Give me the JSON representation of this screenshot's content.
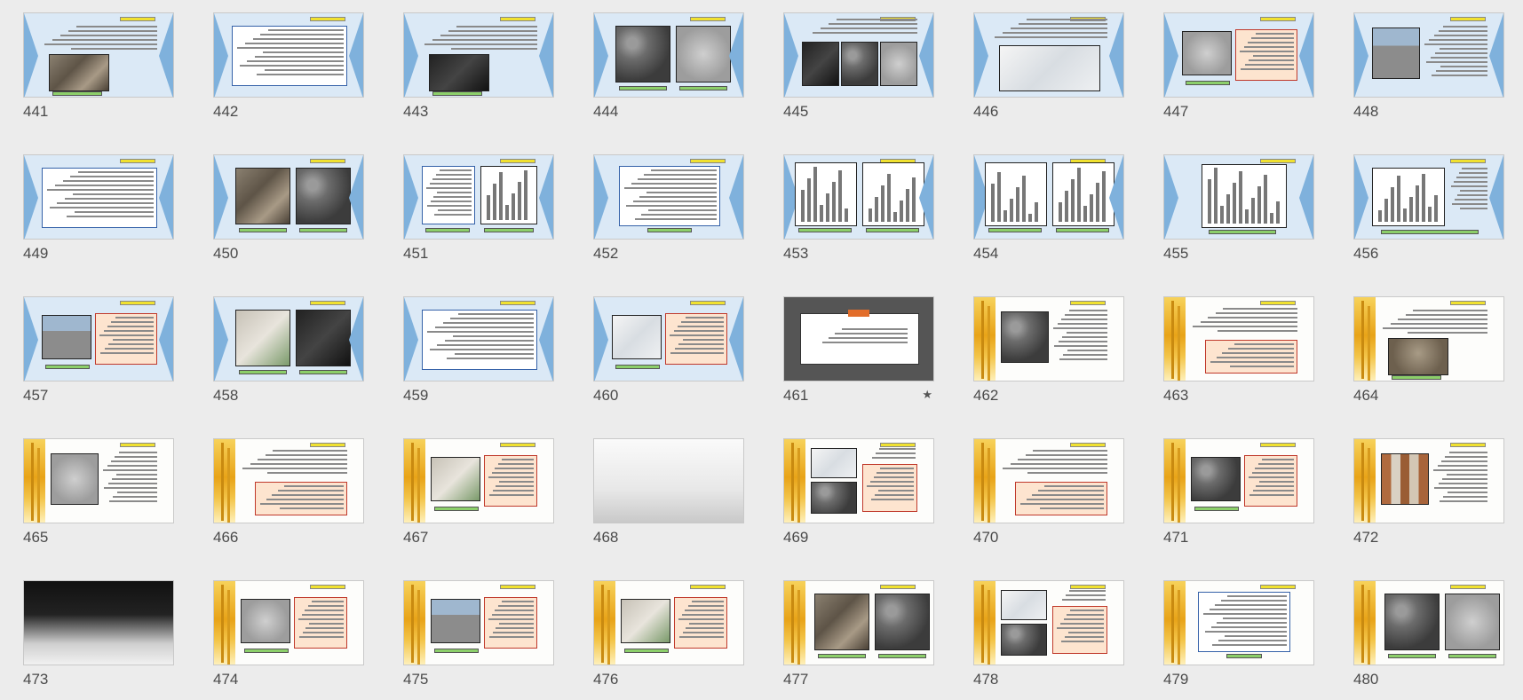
{
  "slides": [
    {
      "number": "441",
      "theme": "blue",
      "layout": "text-pic"
    },
    {
      "number": "442",
      "theme": "blue",
      "layout": "text"
    },
    {
      "number": "443",
      "theme": "blue",
      "layout": "text-pic"
    },
    {
      "number": "444",
      "theme": "blue",
      "layout": "two-pics"
    },
    {
      "number": "445",
      "theme": "blue",
      "layout": "three-pics"
    },
    {
      "number": "446",
      "theme": "blue",
      "layout": "wide-pic"
    },
    {
      "number": "447",
      "theme": "blue",
      "layout": "pic-box"
    },
    {
      "number": "448",
      "theme": "blue",
      "layout": "pic-text"
    },
    {
      "number": "449",
      "theme": "blue",
      "layout": "text"
    },
    {
      "number": "450",
      "theme": "blue",
      "layout": "two-pics"
    },
    {
      "number": "451",
      "theme": "blue",
      "layout": "table-chart"
    },
    {
      "number": "452",
      "theme": "blue",
      "layout": "table"
    },
    {
      "number": "453",
      "theme": "blue",
      "layout": "two-charts"
    },
    {
      "number": "454",
      "theme": "blue",
      "layout": "two-charts"
    },
    {
      "number": "455",
      "theme": "blue",
      "layout": "chart"
    },
    {
      "number": "456",
      "theme": "blue",
      "layout": "chart-text"
    },
    {
      "number": "457",
      "theme": "blue",
      "layout": "pic-box"
    },
    {
      "number": "458",
      "theme": "blue",
      "layout": "two-pics"
    },
    {
      "number": "459",
      "theme": "blue",
      "layout": "text"
    },
    {
      "number": "460",
      "theme": "blue",
      "layout": "pic-box"
    },
    {
      "number": "461",
      "theme": "dark",
      "layout": "section",
      "starred": true
    },
    {
      "number": "462",
      "theme": "wheat",
      "layout": "pic-text"
    },
    {
      "number": "463",
      "theme": "wheat",
      "layout": "text-box"
    },
    {
      "number": "464",
      "theme": "wheat",
      "layout": "text-pic"
    },
    {
      "number": "465",
      "theme": "wheat",
      "layout": "pic-text"
    },
    {
      "number": "466",
      "theme": "wheat",
      "layout": "text-box"
    },
    {
      "number": "467",
      "theme": "wheat",
      "layout": "pic-box"
    },
    {
      "number": "468",
      "theme": "gray",
      "layout": "photo"
    },
    {
      "number": "469",
      "theme": "wheat",
      "layout": "pics-box"
    },
    {
      "number": "470",
      "theme": "wheat",
      "layout": "text-box"
    },
    {
      "number": "471",
      "theme": "wheat",
      "layout": "pic-box"
    },
    {
      "number": "472",
      "theme": "wheat",
      "layout": "pic-text"
    },
    {
      "number": "473",
      "theme": "night",
      "layout": "photo"
    },
    {
      "number": "474",
      "theme": "wheat",
      "layout": "pic-box"
    },
    {
      "number": "475",
      "theme": "wheat",
      "layout": "pic-box"
    },
    {
      "number": "476",
      "theme": "wheat",
      "layout": "pic-box"
    },
    {
      "number": "477",
      "theme": "wheat",
      "layout": "two-pics"
    },
    {
      "number": "478",
      "theme": "wheat",
      "layout": "pics-box"
    },
    {
      "number": "479",
      "theme": "wheat",
      "layout": "table"
    },
    {
      "number": "480",
      "theme": "wheat",
      "layout": "two-pics"
    }
  ]
}
